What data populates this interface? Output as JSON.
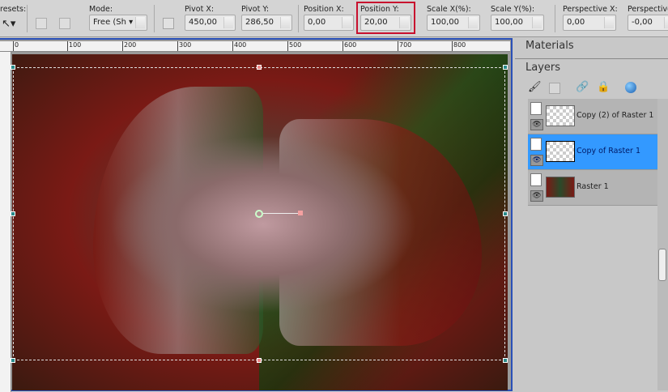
{
  "toolbar": {
    "presets_label": "resets:",
    "mode_label": "Mode:",
    "mode_value": "Free (Sh",
    "pivot_x_label": "Pivot X:",
    "pivot_x": "450,00",
    "pivot_y_label": "Pivot Y:",
    "pivot_y": "286,50",
    "pos_x_label": "Position X:",
    "pos_x": "0,00",
    "pos_y_label": "Position Y:",
    "pos_y": "20,00",
    "scale_x_label": "Scale X(%):",
    "scale_x": "100,00",
    "scale_y_label": "Scale Y(%):",
    "scale_y": "100,00",
    "persp_x_label": "Perspective X:",
    "persp_x": "0,00",
    "persp_y_label": "Perspective",
    "persp_y": "-0,00"
  },
  "ruler": [
    "0",
    "100",
    "200",
    "300",
    "400",
    "500",
    "600",
    "700",
    "800"
  ],
  "panels": {
    "materials": "Materials",
    "layers": "Layers"
  },
  "layers": [
    {
      "name": "Copy (2) of Raster 1",
      "selected": false
    },
    {
      "name": "Copy of Raster 1",
      "selected": true
    },
    {
      "name": "Raster 1",
      "selected": false
    }
  ],
  "colors": {
    "highlight": "#c8102e",
    "selection": "#3399ff",
    "window_border": "#2a50b8"
  }
}
